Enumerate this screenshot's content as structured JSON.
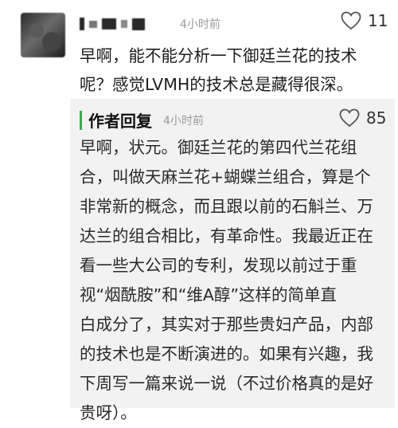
{
  "comment": {
    "time": "4小时前",
    "likes": "11",
    "lines": [
      "早啊，能不能分析一下御廷兰花的技术",
      "呢？感觉LVMH的技术总是藏得很深。"
    ]
  },
  "reply": {
    "tag": "作者回复",
    "time": "4小时前",
    "likes": "85",
    "lines": [
      "早啊，状元。御廷兰花的第四代兰花组",
      "合，叫做天麻兰花+蝴蝶兰组合，算是个",
      "非常新的概念，而且跟以前的石斛兰、万",
      "达兰的组合相比，有革命性。我最近正在",
      "看一些大公司的专利，发现以前过于重",
      "视“烟酰胺”和“维A醇”这样的简单直",
      "白成分了，其实对于那些贵妇产品，内部",
      "的技术也是不断演进的。如果有兴趣，我",
      "下周写一篇来说一说（不过价格真的是好",
      "贵呀）。"
    ]
  },
  "colors": {
    "accent_green": "#35b14b",
    "reply_background": "#f2f2f2",
    "meta_gray": "#9a9a9a"
  },
  "icons": {
    "like": "heart-outline-icon"
  }
}
